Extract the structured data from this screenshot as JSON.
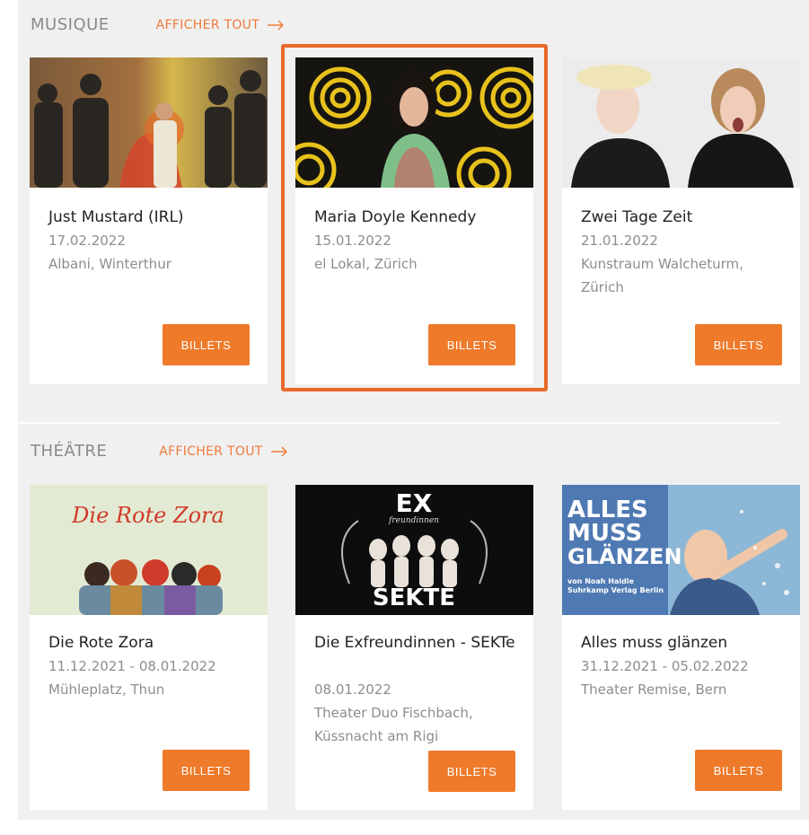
{
  "colors": {
    "accent": "#ee7a2a",
    "highlight": "#e8692a",
    "panel": "#f0f0f0"
  },
  "sections": [
    {
      "title": "MUSIQUE",
      "see_all": "AFFICHER TOUT",
      "cards": [
        {
          "title": "Just Mustard (IRL)",
          "date": "17.02.2022",
          "venue": "Albani, Winterthur",
          "button": "BILLETS",
          "image": "band-photo"
        },
        {
          "title": "Maria Doyle Kennedy",
          "date": "15.01.2022",
          "venue": "el Lokal, Zürich",
          "button": "BILLETS",
          "image": "artist-portrait"
        },
        {
          "title": "Zwei Tage Zeit",
          "date": "21.01.2022",
          "venue": "Kunstraum Walcheturm, Zürich",
          "button": "BILLETS",
          "image": "duo-photo"
        }
      ]
    },
    {
      "title": "THÉÂTRE",
      "see_all": "AFFICHER TOUT",
      "cards": [
        {
          "title": "Die Rote Zora",
          "date": "11.12.2021 - 08.01.2022",
          "venue": "Mühleplatz, Thun",
          "button": "BILLETS",
          "image": "poster-illustration",
          "poster_text": "Die Rote Zora"
        },
        {
          "title": "Die Exfreundinnen - SEKTe",
          "date": "08.01.2022",
          "venue": "Theater Duo Fischbach, Küssnacht am Rigi",
          "button": "BILLETS",
          "image": "show-poster",
          "poster_text": "EX",
          "poster_subtitle": "freundinnen",
          "poster_bottom": "SEKTE"
        },
        {
          "title": "Alles muss glänzen",
          "date": "31.12.2021 - 05.02.2022",
          "venue": "Theater Remise, Bern",
          "button": "BILLETS",
          "image": "show-poster",
          "poster_lines": [
            "ALLES",
            "MUSS",
            "GLÄNZEN"
          ],
          "poster_credit_1": "von Noah Haidle",
          "poster_credit_2": "Suhrkamp Verlag Berlin"
        }
      ]
    }
  ]
}
